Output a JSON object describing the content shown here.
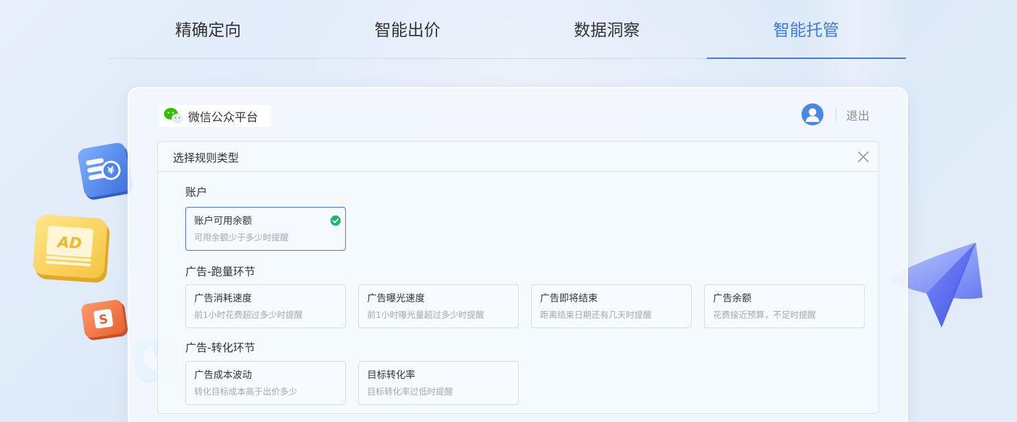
{
  "tabs": [
    {
      "label": "精确定向",
      "active": false
    },
    {
      "label": "智能出价",
      "active": false
    },
    {
      "label": "数据洞察",
      "active": false
    },
    {
      "label": "智能托管",
      "active": true
    }
  ],
  "panel": {
    "brand": "微信公众平台",
    "logout": "退出"
  },
  "modal": {
    "title": "选择规则类型",
    "sections": [
      {
        "title": "账户",
        "cards": [
          {
            "title": "账户可用余额",
            "desc": "可用余额少于多少时提醒",
            "selected": true
          }
        ]
      },
      {
        "title": "广告-跑量环节",
        "cards": [
          {
            "title": "广告消耗速度",
            "desc": "前1小时花费超过多少时提醒"
          },
          {
            "title": "广告曝光速度",
            "desc": "前1小时曝光量超过多少时提醒"
          },
          {
            "title": "广告即将结束",
            "desc": "距离结束日期还有几天时提醒"
          },
          {
            "title": "广告余额",
            "desc": "花费接近预算，不足时提醒"
          }
        ]
      },
      {
        "title": "广告-转化环节",
        "cards": [
          {
            "title": "广告成本波动",
            "desc": "转化目标成本高于出价多少"
          },
          {
            "title": "目标转化率",
            "desc": "目标转化率过低时提醒"
          }
        ]
      }
    ]
  },
  "decorations": {
    "coin_badge": "¥",
    "ad_badge": "AD",
    "s_badge": "S"
  },
  "colors": {
    "accent": "#3f79e0",
    "check": "#1fb86a",
    "wechat": "#2dc100"
  }
}
